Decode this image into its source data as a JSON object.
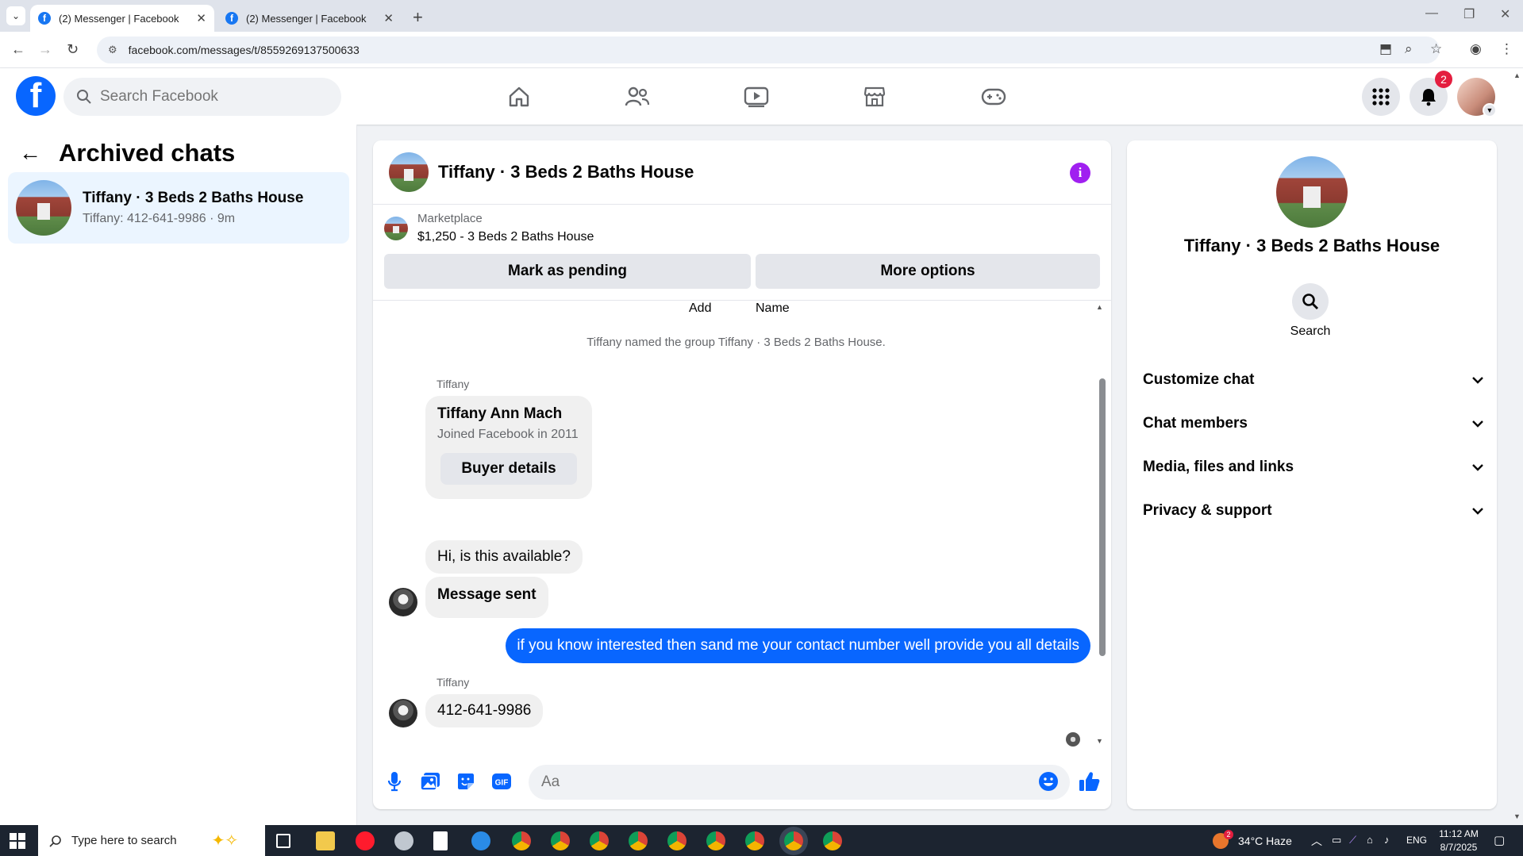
{
  "browser": {
    "tabs": [
      {
        "title": "(2) Messenger | Facebook",
        "active": true
      },
      {
        "title": "(2) Messenger | Facebook",
        "active": false
      }
    ],
    "url": "facebook.com/messages/t/8559269137500633"
  },
  "header": {
    "search_placeholder": "Search Facebook",
    "notification_count": "2"
  },
  "sidebar": {
    "title": "Archived chats",
    "chats": [
      {
        "name": "Tiffany · 3 Beds 2 Baths House",
        "preview": "Tiffany: 412-641-9986 · 9m"
      }
    ]
  },
  "chat": {
    "title": "Tiffany · 3 Beds 2 Baths House",
    "marketplace_label": "Marketplace",
    "listing": "$1,250 - 3 Beds 2 Baths House",
    "mark_pending_label": "Mark as pending",
    "more_options_label": "More options",
    "add_label": "Add",
    "name_label": "Name",
    "system_message": "Tiffany named the group Tiffany · 3 Beds 2 Baths House.",
    "buyer_card": {
      "sender": "Tiffany",
      "name": "Tiffany Ann Mach",
      "joined": "Joined Facebook in 2011",
      "button": "Buyer details"
    },
    "messages": [
      {
        "from": "them",
        "text": "Hi, is this available?"
      },
      {
        "from": "them",
        "text": "Message sent"
      },
      {
        "from": "me",
        "text": "if you know interested then sand me your contact number well provide you all details"
      },
      {
        "from": "them",
        "sender": "Tiffany",
        "text": "412-641-9986"
      }
    ],
    "composer_placeholder": "Aa"
  },
  "details": {
    "name": "Tiffany · 3 Beds 2 Baths House",
    "search_label": "Search",
    "sections": [
      "Customize chat",
      "Chat members",
      "Media, files and links",
      "Privacy & support"
    ]
  },
  "taskbar": {
    "search_placeholder": "Type here to search",
    "weather_badge": "2",
    "weather": "34°C  Haze",
    "lang": "ENG",
    "time": "11:12 AM",
    "date": "8/7/2025"
  },
  "colors": {
    "fb_blue": "#0866ff",
    "accent_purple": "#a020f0",
    "selected_bg": "#ebf5ff",
    "badge_red": "#e41e3f"
  }
}
